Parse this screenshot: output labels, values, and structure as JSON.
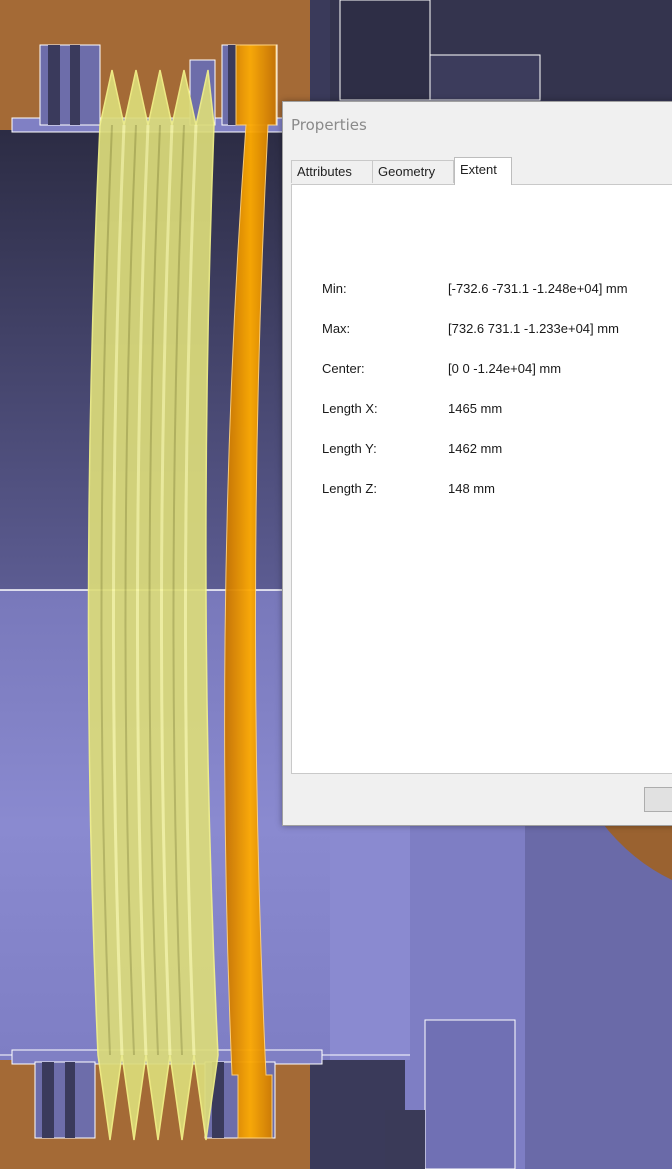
{
  "dialog": {
    "title": "Properties",
    "tabs": [
      {
        "label": "Attributes",
        "active": false
      },
      {
        "label": "Geometry",
        "active": false
      },
      {
        "label": "Extent",
        "active": true
      }
    ],
    "extent": {
      "rows": [
        {
          "label": "Min:",
          "value": "[-732.6 -731.1 -1.248e+04] mm"
        },
        {
          "label": "Max:",
          "value": "[732.6 731.1 -1.233e+04] mm"
        },
        {
          "label": "Center:",
          "value": "[0 0 -1.24e+04] mm"
        },
        {
          "label": "Length X:",
          "value": "1465 mm"
        },
        {
          "label": "Length Y:",
          "value": "1462 mm"
        },
        {
          "label": "Length Z:",
          "value": "148 mm"
        }
      ]
    },
    "ok_label": ""
  },
  "colors": {
    "background_brown": "#a46a36",
    "part_purple": "#8787cc",
    "part_dark": "#2e2e48",
    "bellows_yellow": "#dcdc7a",
    "ring_orange": "#f0a000"
  }
}
